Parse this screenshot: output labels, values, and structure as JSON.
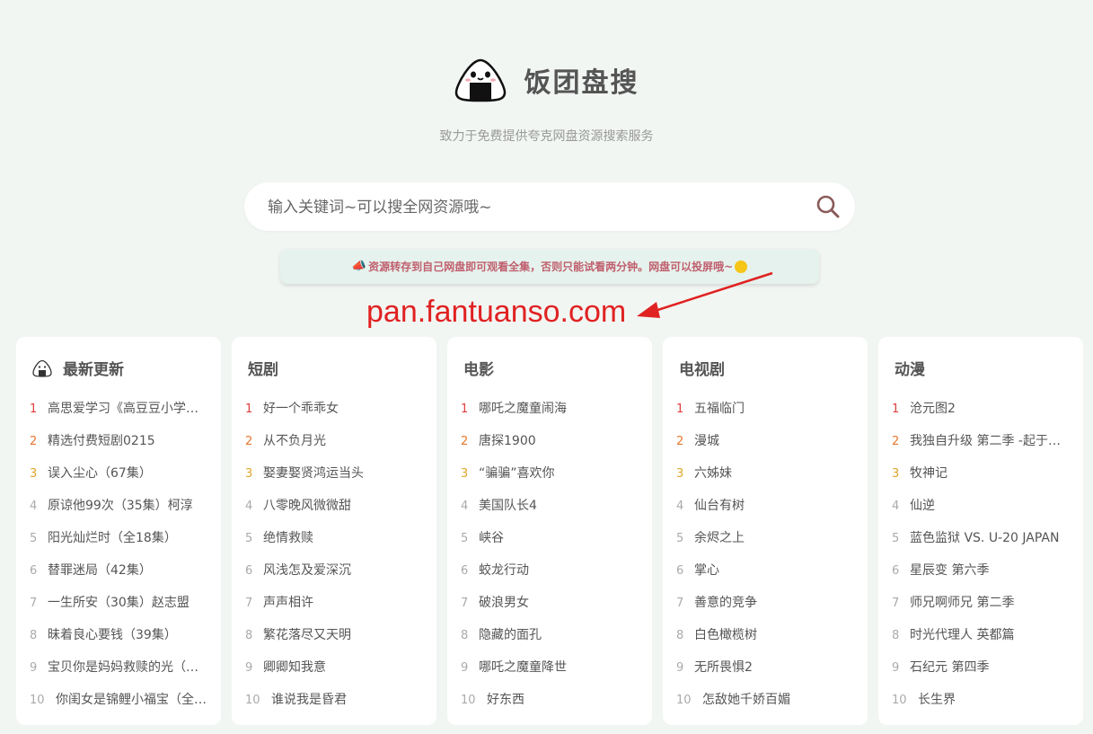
{
  "header": {
    "title": "饭团盘搜",
    "subtitle": "致力于免费提供夸克网盘资源搜索服务"
  },
  "search": {
    "placeholder": "输入关键词~可以搜全网资源哦~",
    "value": ""
  },
  "notice": {
    "text": "资源转存到自己网盘即可观看全集，否则只能试看两分钟。网盘可以投屏哦~"
  },
  "annotation": {
    "url": "pan.fantuanso.com",
    "color": "#e02222"
  },
  "colors": {
    "background": "#f2f6f3",
    "rank1": "#e03e3e",
    "rank2": "#e7762d",
    "rank3": "#e0a52a",
    "notice_text": "#c05f6e"
  },
  "categories": [
    {
      "title": "最新更新",
      "icon": "onigiri-icon",
      "items": [
        {
          "rank": "1",
          "text": "高思爱学习《高豆豆小学数学全集》"
        },
        {
          "rank": "2",
          "text": "精选付费短剧0215"
        },
        {
          "rank": "3",
          "text": "误入尘心（67集）"
        },
        {
          "rank": "4",
          "text": "原谅他99次（35集）柯淳"
        },
        {
          "rank": "5",
          "text": "阳光灿烂时（全18集）"
        },
        {
          "rank": "6",
          "text": "替罪迷局（42集）"
        },
        {
          "rank": "7",
          "text": "一生所安（30集）赵志盟"
        },
        {
          "rank": "8",
          "text": "昧着良心要钱（39集）"
        },
        {
          "rank": "9",
          "text": "宝贝你是妈妈救赎的光（全集）"
        },
        {
          "rank": "10",
          "text": "你闺女是锦鲤小福宝（全集）"
        }
      ]
    },
    {
      "title": "短剧",
      "items": [
        {
          "rank": "1",
          "text": "好一个乖乖女"
        },
        {
          "rank": "2",
          "text": "从不负月光"
        },
        {
          "rank": "3",
          "text": "娶妻娶贤鸿运当头"
        },
        {
          "rank": "4",
          "text": "八零晚风微微甜"
        },
        {
          "rank": "5",
          "text": "绝情救赎"
        },
        {
          "rank": "6",
          "text": "风浅怎及爱深沉"
        },
        {
          "rank": "7",
          "text": "声声相许"
        },
        {
          "rank": "8",
          "text": "繁花落尽又天明"
        },
        {
          "rank": "9",
          "text": "卿卿知我意"
        },
        {
          "rank": "10",
          "text": "谁说我是昏君"
        }
      ]
    },
    {
      "title": "电影",
      "items": [
        {
          "rank": "1",
          "text": "哪吒之魔童闹海"
        },
        {
          "rank": "2",
          "text": "唐探1900"
        },
        {
          "rank": "3",
          "text": "“骗骗”喜欢你"
        },
        {
          "rank": "4",
          "text": "美国队长4"
        },
        {
          "rank": "5",
          "text": "峡谷"
        },
        {
          "rank": "6",
          "text": "蛟龙行动"
        },
        {
          "rank": "7",
          "text": "破浪男女"
        },
        {
          "rank": "8",
          "text": "隐藏的面孔"
        },
        {
          "rank": "9",
          "text": "哪吒之魔童降世"
        },
        {
          "rank": "10",
          "text": "好东西"
        }
      ]
    },
    {
      "title": "电视剧",
      "items": [
        {
          "rank": "1",
          "text": "五福临门"
        },
        {
          "rank": "2",
          "text": "漫城"
        },
        {
          "rank": "3",
          "text": "六姊妹"
        },
        {
          "rank": "4",
          "text": "仙台有树"
        },
        {
          "rank": "5",
          "text": "余烬之上"
        },
        {
          "rank": "6",
          "text": "掌心"
        },
        {
          "rank": "7",
          "text": "善意的竞争"
        },
        {
          "rank": "8",
          "text": "白色橄榄树"
        },
        {
          "rank": "9",
          "text": "无所畏惧2"
        },
        {
          "rank": "10",
          "text": "怎敌她千娇百媚"
        }
      ]
    },
    {
      "title": "动漫",
      "items": [
        {
          "rank": "1",
          "text": "沧元图2"
        },
        {
          "rank": "2",
          "text": "我独自升级 第二季 -起于暗影-"
        },
        {
          "rank": "3",
          "text": "牧神记"
        },
        {
          "rank": "4",
          "text": "仙逆"
        },
        {
          "rank": "5",
          "text": "蓝色监狱 VS. U-20 JAPAN"
        },
        {
          "rank": "6",
          "text": "星辰变 第六季"
        },
        {
          "rank": "7",
          "text": "师兄啊师兄 第二季"
        },
        {
          "rank": "8",
          "text": "时光代理人 英都篇"
        },
        {
          "rank": "9",
          "text": "石纪元 第四季"
        },
        {
          "rank": "10",
          "text": "长生界"
        }
      ]
    }
  ]
}
